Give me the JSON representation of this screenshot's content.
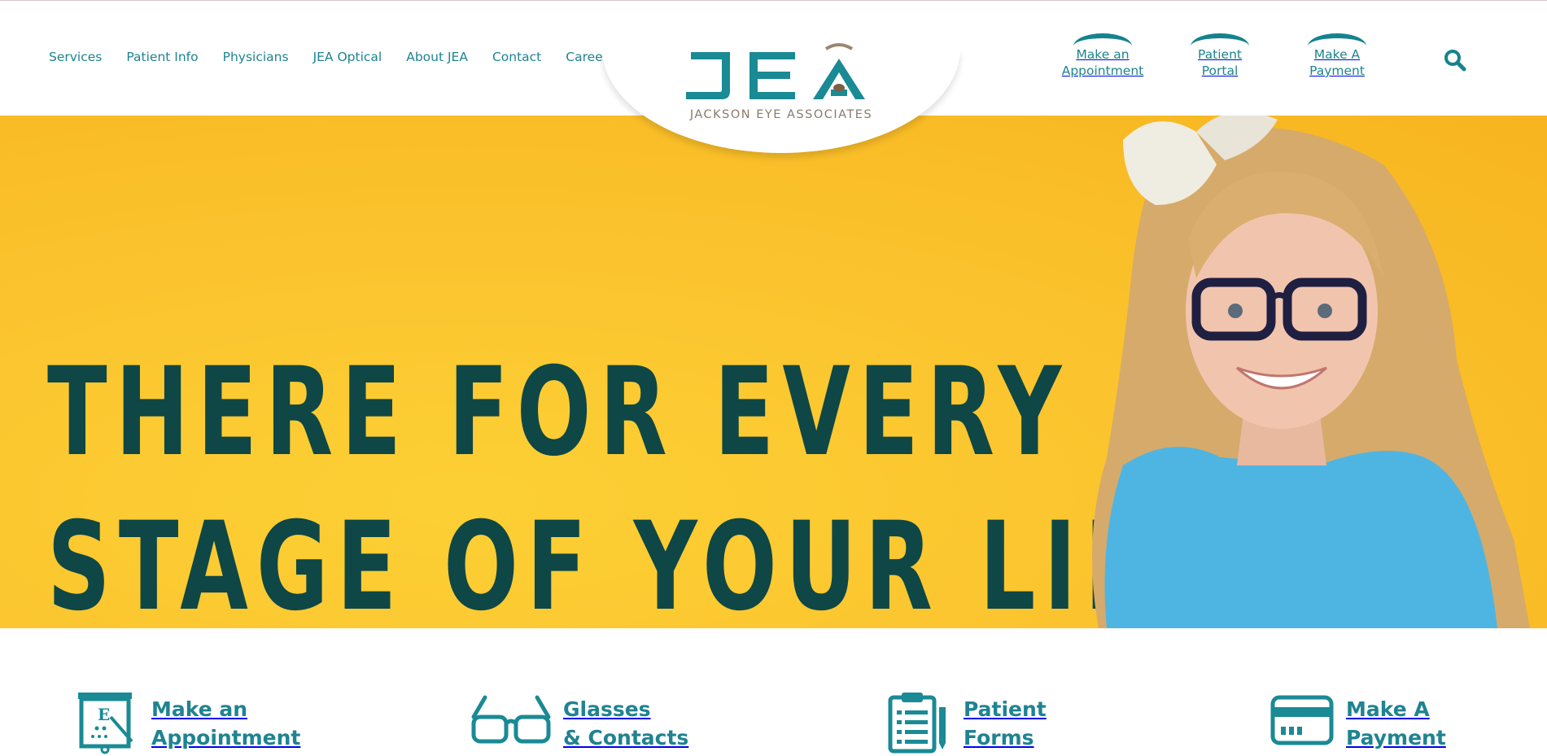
{
  "nav": {
    "items": [
      "Services",
      "Patient Info",
      "Physicians",
      "JEA Optical",
      "About JEA",
      "Contact",
      "Careers"
    ]
  },
  "logo": {
    "text": "JEA",
    "subtitle": "JACKSON EYE ASSOCIATES"
  },
  "quick_links": [
    {
      "line1": "Make an",
      "line2": "Appointment"
    },
    {
      "line1": "Patient",
      "line2": "Portal"
    },
    {
      "line1": "Make A",
      "line2": "Payment"
    }
  ],
  "hero": {
    "line1": "THERE FOR EVERY",
    "line2": "STAGE OF YOUR LIFE"
  },
  "actions": [
    {
      "line1": "Make an",
      "line2": "Appointment",
      "icon": "eye-chart-icon"
    },
    {
      "line1": "Glasses",
      "line2": "& Contacts",
      "icon": "glasses-icon"
    },
    {
      "line1": "Patient",
      "line2": "Forms",
      "icon": "clipboard-icon"
    },
    {
      "line1": "Make A",
      "line2": "Payment",
      "icon": "credit-card-icon"
    }
  ],
  "colors": {
    "teal": "#1f8391",
    "hero_yellow": "#fbc42e",
    "headline": "#0e4746"
  }
}
